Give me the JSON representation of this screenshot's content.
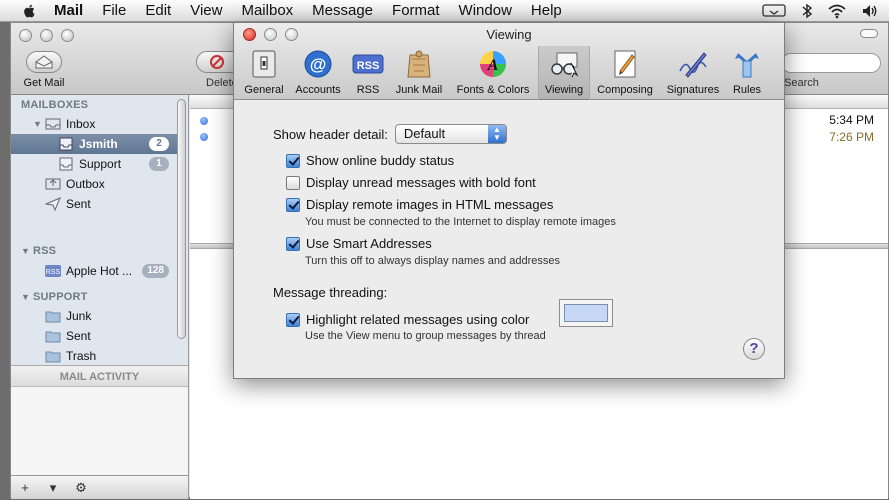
{
  "menubar": {
    "app": "Mail",
    "items": [
      "File",
      "Edit",
      "View",
      "Mailbox",
      "Message",
      "Format",
      "Window",
      "Help"
    ]
  },
  "toolbar": {
    "get_mail": "Get Mail",
    "delete": "Delete",
    "search": "Search"
  },
  "sidebar": {
    "mailboxes_header": "MAILBOXES",
    "inbox": "Inbox",
    "jsmith": "Jsmith",
    "jsmith_count": "2",
    "support": "Support",
    "support_count": "1",
    "outbox": "Outbox",
    "sent": "Sent",
    "rss_header": "RSS",
    "apple_hot": "Apple Hot ...",
    "apple_hot_count": "128",
    "support_header": "SUPPORT",
    "junk": "Junk",
    "sent2": "Sent",
    "trash": "Trash",
    "mail_activity": "MAIL ACTIVITY"
  },
  "messages": [
    {
      "time": "5:34 PM",
      "color": "#111111"
    },
    {
      "time": "7:26 PM",
      "color": "#8a6a2a"
    }
  ],
  "prefs": {
    "title": "Viewing",
    "tabs": [
      {
        "label": "General",
        "icon": "general-icon"
      },
      {
        "label": "Accounts",
        "icon": "accounts-icon"
      },
      {
        "label": "RSS",
        "icon": "rss-icon"
      },
      {
        "label": "Junk Mail",
        "icon": "junk-mail-icon"
      },
      {
        "label": "Fonts & Colors",
        "icon": "fonts-colors-icon"
      },
      {
        "label": "Viewing",
        "icon": "viewing-icon"
      },
      {
        "label": "Composing",
        "icon": "composing-icon"
      },
      {
        "label": "Signatures",
        "icon": "signatures-icon"
      },
      {
        "label": "Rules",
        "icon": "rules-icon"
      }
    ],
    "header_detail_label": "Show header detail:",
    "header_detail_value": "Default",
    "opt_buddy": "Show online buddy status",
    "opt_bold": "Display unread messages with bold font",
    "opt_images": "Display remote images in HTML messages",
    "opt_images_note": "You must be connected to the Internet to display remote images",
    "opt_smart": "Use Smart Addresses",
    "opt_smart_note": "Turn this off to always display names and addresses",
    "threading_label": "Message threading:",
    "opt_highlight": "Highlight related messages using color",
    "opt_highlight_note": "Use the View menu to group messages by thread",
    "highlight_color": "#c6d8f5",
    "help": "?"
  }
}
